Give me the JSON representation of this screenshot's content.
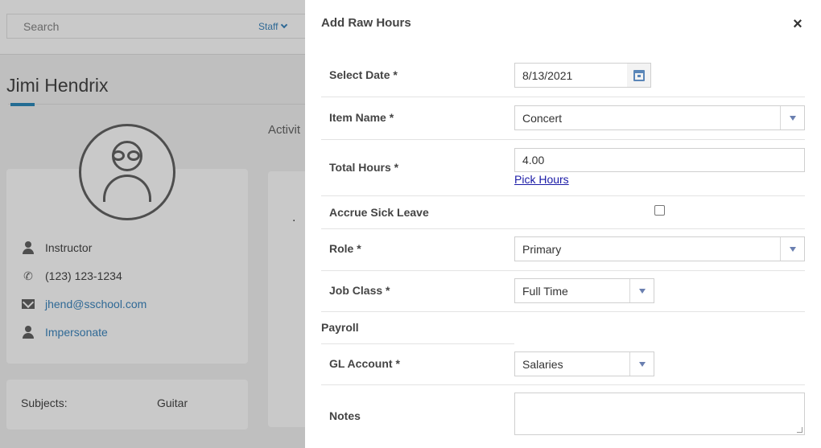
{
  "background": {
    "search_placeholder": "Search",
    "staff_filter": "Staff",
    "person_name": "Jimi Hendrix",
    "activity_tab": "Activit",
    "profile": {
      "role": "Instructor",
      "phone": "(123) 123-1234",
      "email": "jhend@sschool.com",
      "impersonate": "Impersonate"
    },
    "subjects_label": "Subjects:",
    "subjects_value": "Guitar",
    "activity_marker": "."
  },
  "modal": {
    "title": "Add Raw Hours",
    "close_symbol": "×",
    "fields": {
      "select_date": {
        "label": "Select Date *",
        "value": "8/13/2021"
      },
      "item_name": {
        "label": "Item Name *",
        "value": "Concert"
      },
      "total_hours": {
        "label": "Total Hours *",
        "value": "4.00",
        "link": "Pick Hours"
      },
      "accrue_sick_leave": {
        "label": "Accrue Sick Leave",
        "checked": false
      },
      "role": {
        "label": "Role *",
        "value": "Primary"
      },
      "job_class": {
        "label": "Job Class *",
        "value": "Full Time"
      },
      "payroll_section": "Payroll",
      "gl_account": {
        "label": "GL Account *",
        "value": "Salaries"
      },
      "notes": {
        "label": "Notes",
        "value": ""
      }
    }
  },
  "icons": [
    "calendar-icon",
    "dropdown-arrow-icon",
    "close-icon",
    "person-icon",
    "phone-icon",
    "email-icon",
    "chevron-down-icon",
    "avatar-icon"
  ],
  "colors": {
    "link": "#2a7ab8",
    "accent": "#1a7fb5",
    "dropdown_arrow": "#6a7fb0"
  }
}
